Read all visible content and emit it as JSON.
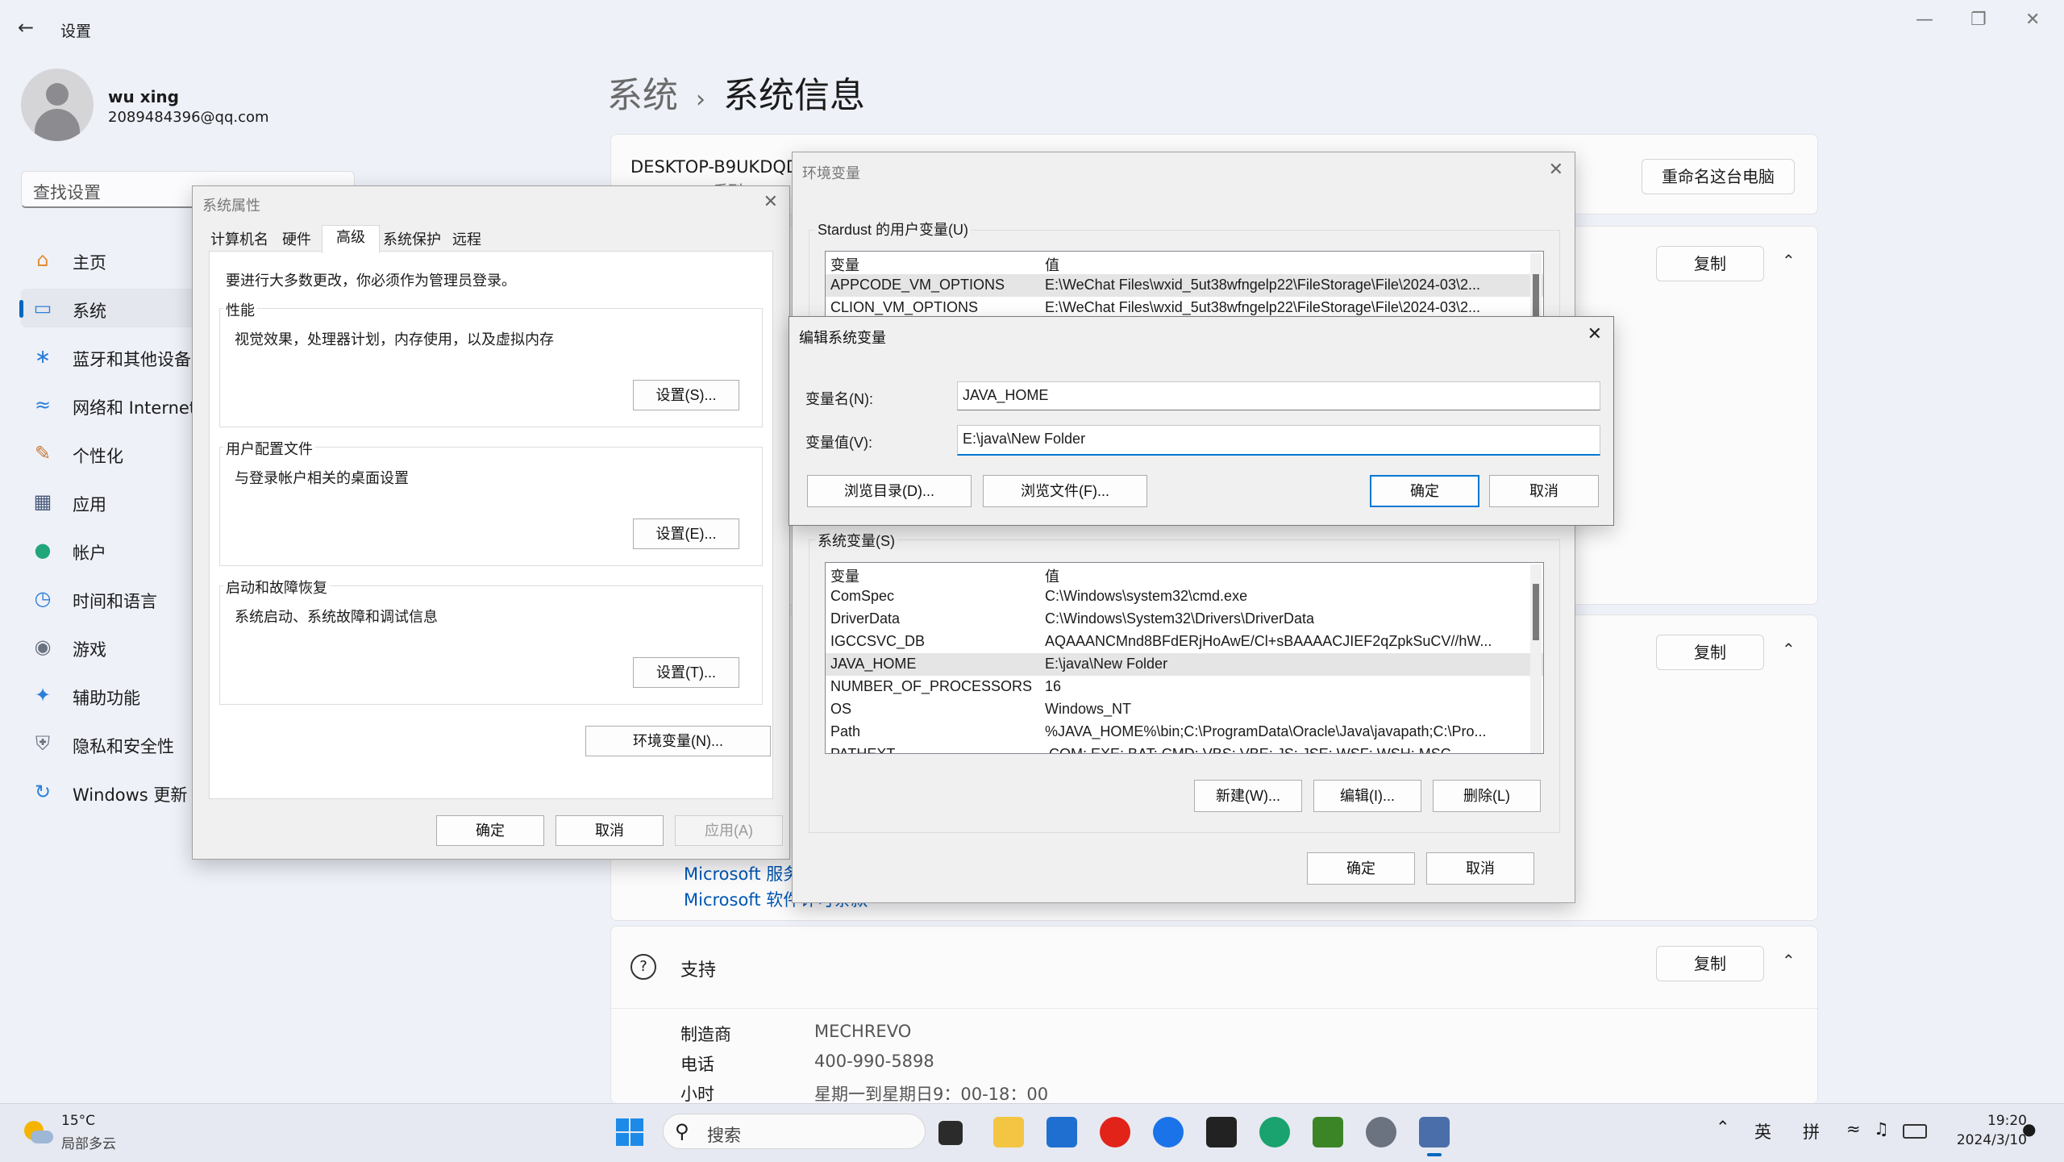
{
  "app": {
    "title": "设置"
  },
  "user": {
    "name": "wu xing",
    "email": "2089484396@qq.com"
  },
  "search": {
    "placeholder": "查找设置"
  },
  "nav": [
    {
      "label": "主页",
      "icon": "home-icon"
    },
    {
      "label": "系统",
      "icon": "system-icon",
      "selected": true
    },
    {
      "label": "蓝牙和其他设备",
      "icon": "bluetooth-icon"
    },
    {
      "label": "网络和 Internet",
      "icon": "wifi-icon"
    },
    {
      "label": "个性化",
      "icon": "brush-icon"
    },
    {
      "label": "应用",
      "icon": "apps-icon"
    },
    {
      "label": "帐户",
      "icon": "account-icon"
    },
    {
      "label": "时间和语言",
      "icon": "clock-globe-icon"
    },
    {
      "label": "游戏",
      "icon": "gamepad-icon"
    },
    {
      "label": "辅助功能",
      "icon": "accessibility-icon"
    },
    {
      "label": "隐私和安全性",
      "icon": "shield-icon"
    },
    {
      "label": "Windows 更新",
      "icon": "update-icon"
    }
  ],
  "breadcrumb": {
    "parent": "系统",
    "sep": "›",
    "current": "系统信息"
  },
  "device": {
    "name": "DESKTOP-B9UKDQD",
    "model": "MECHREVO系列",
    "rename_label": "重命名这台电脑"
  },
  "copy_label": "复制",
  "links": {
    "services": "Microsoft 服务协议",
    "license": "Microsoft 软件许可条款"
  },
  "support": {
    "title": "支持",
    "rows": [
      {
        "label": "制造商",
        "value": "MECHREVO"
      },
      {
        "label": "电话",
        "value": "400-990-5898"
      },
      {
        "label": "小时",
        "value": "星期一到星期日9：00-18：00"
      }
    ]
  },
  "sysprops": {
    "title": "系统属性",
    "tabs": [
      "计算机名",
      "硬件",
      "高级",
      "系统保护",
      "远程"
    ],
    "active_tab": "高级",
    "notice": "要进行大多数更改，你必须作为管理员登录。",
    "groups": [
      {
        "title": "性能",
        "desc": "视觉效果，处理器计划，内存使用，以及虚拟内存",
        "button": "设置(S)..."
      },
      {
        "title": "用户配置文件",
        "desc": "与登录帐户相关的桌面设置",
        "button": "设置(E)..."
      },
      {
        "title": "启动和故障恢复",
        "desc": "系统启动、系统故障和调试信息",
        "button": "设置(T)..."
      }
    ],
    "env_button": "环境变量(N)...",
    "ok": "确定",
    "cancel": "取消",
    "apply": "应用(A)"
  },
  "envvars": {
    "title": "环境变量",
    "user_section": "Stardust 的用户变量(U)",
    "col_var": "变量",
    "col_val": "值",
    "user_rows": [
      {
        "name": "APPCODE_VM_OPTIONS",
        "value": "E:\\WeChat Files\\wxid_5ut38wfngelp22\\FileStorage\\File\\2024-03\\2..."
      },
      {
        "name": "CLION_VM_OPTIONS",
        "value": "E:\\WeChat Files\\wxid_5ut38wfngelp22\\FileStorage\\File\\2024-03\\2..."
      }
    ],
    "sys_section": "系统变量(S)",
    "sys_rows": [
      {
        "name": "ComSpec",
        "value": "C:\\Windows\\system32\\cmd.exe"
      },
      {
        "name": "DriverData",
        "value": "C:\\Windows\\System32\\Drivers\\DriverData"
      },
      {
        "name": "IGCCSVC_DB",
        "value": "AQAAANCMnd8BFdERjHoAwE/Cl+sBAAAACJIEF2qZpkSuCV//hW..."
      },
      {
        "name": "JAVA_HOME",
        "value": "E:\\java\\New Folder",
        "selected": true
      },
      {
        "name": "NUMBER_OF_PROCESSORS",
        "value": "16"
      },
      {
        "name": "OS",
        "value": "Windows_NT"
      },
      {
        "name": "Path",
        "value": "%JAVA_HOME%\\bin;C:\\ProgramData\\Oracle\\Java\\javapath;C:\\Pro..."
      },
      {
        "name": "PATHEXT",
        "value": ".COM;.EXE;.BAT;.CMD;.VBS;.VBE;.JS;.JSE;.WSF;.WSH;.MSC"
      }
    ],
    "new": "新建(W)...",
    "edit": "编辑(I)...",
    "delete": "删除(L)",
    "ok": "确定",
    "cancel": "取消"
  },
  "editvar": {
    "title": "编辑系统变量",
    "name_label": "变量名(N):",
    "name_value": "JAVA_HOME",
    "value_label": "变量值(V):",
    "value_value": "E:\\java\\New Folder",
    "browse_dir": "浏览目录(D)...",
    "browse_file": "浏览文件(F)...",
    "ok": "确定",
    "cancel": "取消"
  },
  "taskbar": {
    "weather_temp": "15°C",
    "weather_desc": "局部多云",
    "search_placeholder": "搜索",
    "ime_lang": "英",
    "ime_mode": "拼",
    "time": "19:20",
    "date": "2024/3/10"
  }
}
